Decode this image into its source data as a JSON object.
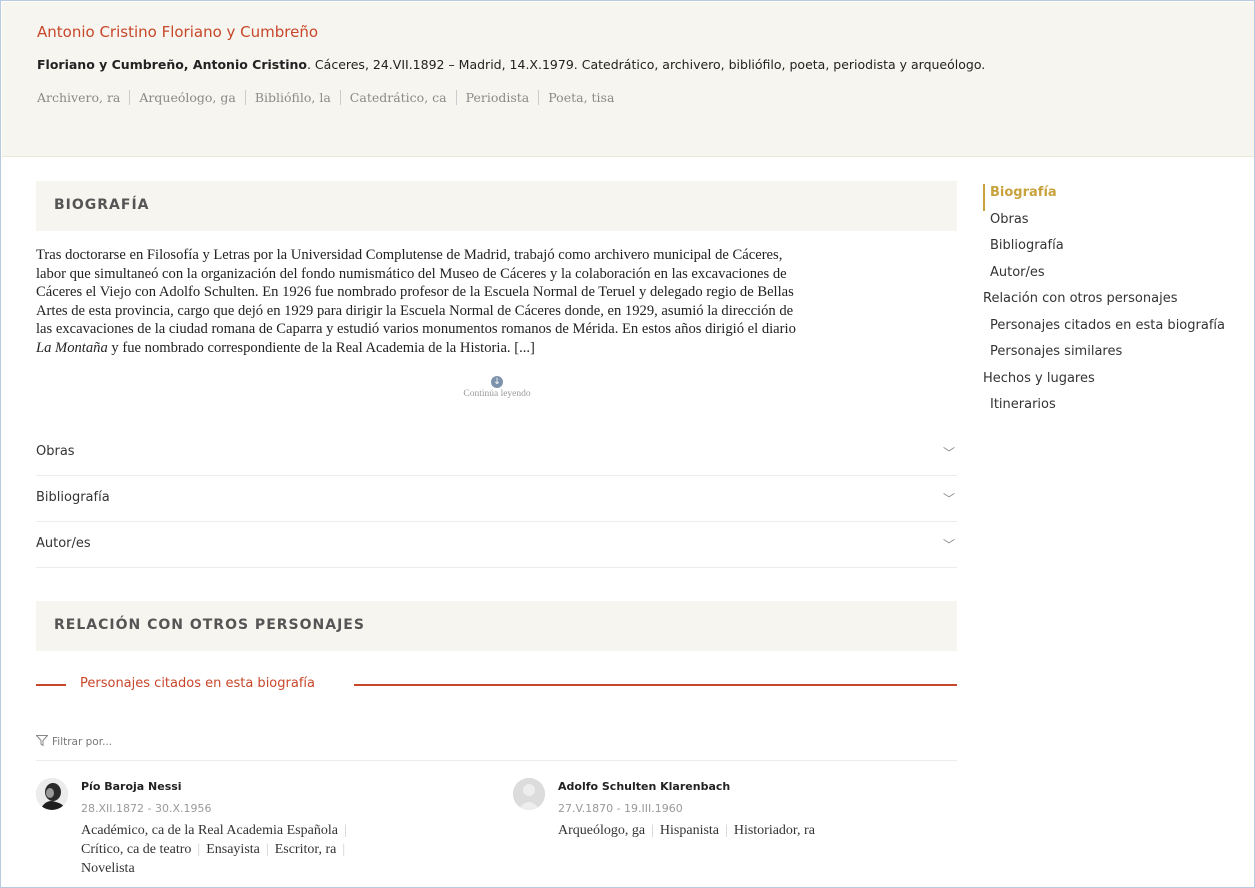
{
  "header": {
    "title": "Antonio Cristino Floriano y Cumbreño",
    "name_bold": "Floriano y Cumbreño, Antonio Cristino",
    "summary": ". Cáceres, 24.VII.1892 – Madrid, 14.X.1979. Catedrático, archivero, bibliófilo, poeta, periodista y arqueólogo.",
    "categories": [
      "Archivero, ra",
      "Arqueólogo, ga",
      "Bibliófilo, la",
      "Catedrático, ca",
      "Periodista",
      "Poeta, tisa"
    ]
  },
  "biografia": {
    "heading": "BIOGRAFÍA",
    "lines": [
      "Tras doctorarse en Filosofía y Letras por la Universidad Complutense de Madrid, trabajó como archivero municipal de Cáceres,",
      "labor que simultaneó con la organización del fondo numismático del Museo de Cáceres y la colaboración en las excavaciones de",
      "Cáceres el Viejo con Adolfo Schulten. En 1926 fue nombrado profesor de la Escuela Normal de Teruel y delegado regio de Bellas",
      "Artes de esta provincia, cargo que dejó en 1929 para dirigir la Escuela Normal de Cáceres donde, en 1929, asumió la dirección de",
      "las excavaciones de la ciudad romana de Caparra y estudió varios monumentos romanos de Mérida. En estos años dirigió el diario"
    ],
    "last_line_italic": "La Montaña",
    "last_line_rest": " y fue nombrado correspondiente de la Real Academia de la Historia. [...]",
    "read_more": "Continúa leyendo",
    "read_more_icon": "arrow-down-icon"
  },
  "accordion": [
    {
      "label": "Obras"
    },
    {
      "label": "Bibliografía"
    },
    {
      "label": "Autor/es"
    }
  ],
  "relacion": {
    "heading": "RELACIÓN CON OTROS PERSONAJES",
    "subheading": "Personajes citados en esta biografía",
    "filter": "Filtrar por...",
    "persons": [
      {
        "name": "Pío Baroja Nessi",
        "dates": "28.XII.1872 - 30.X.1956",
        "roles": [
          "Académico, ca de la Real Academia Española",
          "Crítico, ca de teatro",
          "Ensayista",
          "Escritor, ra",
          "Novelista"
        ]
      },
      {
        "name": "Adolfo Schulten Klarenbach",
        "dates": "27.V.1870 - 19.III.1960",
        "roles": [
          "Arqueólogo, ga",
          "Hispanista",
          "Historiador, ra"
        ]
      }
    ]
  },
  "nav": [
    {
      "label": "Biografía",
      "level": "sub",
      "active": true
    },
    {
      "label": "Obras",
      "level": "sub"
    },
    {
      "label": "Bibliografía",
      "level": "sub"
    },
    {
      "label": "Autor/es",
      "level": "sub"
    },
    {
      "label": "Relación con otros personajes",
      "level": "top"
    },
    {
      "label": "Personajes citados en esta biografía",
      "level": "sub"
    },
    {
      "label": "Personajes similares",
      "level": "sub"
    },
    {
      "label": "Hechos y lugares",
      "level": "top"
    },
    {
      "label": "Itinerarios",
      "level": "sub"
    }
  ],
  "colors": {
    "accent": "#c8462a",
    "nav_active": "#c8a23c",
    "panel_bg": "#f7f5ef"
  }
}
